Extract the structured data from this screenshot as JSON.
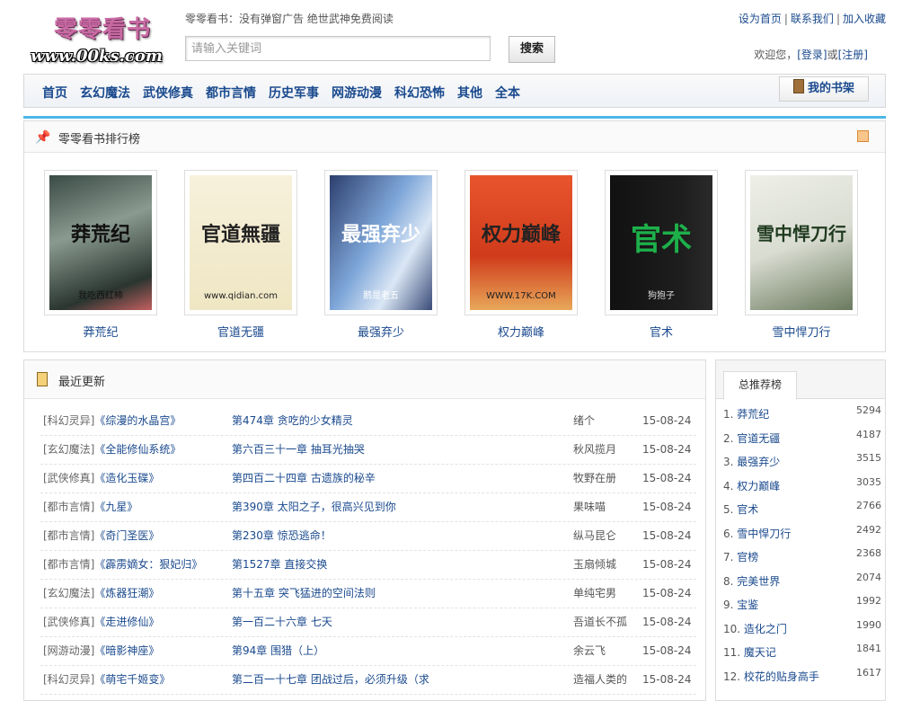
{
  "header": {
    "logo_cn": "零零看书",
    "logo_en": "www.00ks.com",
    "slogan": "零零看书：没有弹窗广告 绝世武神免费阅读",
    "top_links": [
      "设为首页",
      "联系我们",
      "加入收藏"
    ],
    "search_placeholder": "请输入关键词",
    "search_button": "搜索",
    "welcome_text": "欢迎您，",
    "login": "[登录]",
    "or": "或",
    "register": "[注册]"
  },
  "nav": {
    "items": [
      "首页",
      "玄幻魔法",
      "武侠修真",
      "都市言情",
      "历史军事",
      "网游动漫",
      "科幻恐怖",
      "其他",
      "全本"
    ],
    "shelf": "我的书架"
  },
  "ranking": {
    "title": "零零看书排行榜",
    "books": [
      {
        "name": "莽荒纪",
        "cover_title": "莽荒纪",
        "cover_author": "我吃西红柿"
      },
      {
        "name": "官道无疆",
        "cover_title": "官道無疆",
        "cover_author": "www.qidian.com"
      },
      {
        "name": "最强弃少",
        "cover_title": "最强弃少",
        "cover_author": "鹅是老五"
      },
      {
        "name": "权力巅峰",
        "cover_title": "权力巅峰",
        "cover_author": "WWW.17K.COM"
      },
      {
        "name": "官术",
        "cover_title": "官术",
        "cover_author": "狗狍子"
      },
      {
        "name": "雪中悍刀行",
        "cover_title": "雪中悍刀行",
        "cover_author": ""
      }
    ]
  },
  "recent": {
    "title": "最近更新",
    "rows": [
      {
        "cat": "[科幻灵异]",
        "book": "《综漫的水晶宫》",
        "chapter": "第474章 贪吃的少女精灵",
        "author": "绪个",
        "date": "15-08-24"
      },
      {
        "cat": "[玄幻魔法]",
        "book": "《全能修仙系统》",
        "chapter": "第六百三十一章 抽耳光抽哭",
        "author": "秋风揽月",
        "date": "15-08-24"
      },
      {
        "cat": "[武侠修真]",
        "book": "《造化玉碟》",
        "chapter": "第四百二十四章 古遗族的秘辛",
        "author": "牧野在册",
        "date": "15-08-24"
      },
      {
        "cat": "[都市言情]",
        "book": "《九星》",
        "chapter": "第390章 太阳之子，很高兴见到你",
        "author": "果味喵",
        "date": "15-08-24"
      },
      {
        "cat": "[都市言情]",
        "book": "《奇门圣医》",
        "chapter": "第230章 惊恐逃命！",
        "author": "纵马昆仑",
        "date": "15-08-24"
      },
      {
        "cat": "[都市言情]",
        "book": "《霹雳嫡女：狠妃归》",
        "chapter": "第1527章 直接交换",
        "author": "玉扇倾城",
        "date": "15-08-24"
      },
      {
        "cat": "[玄幻魔法]",
        "book": "《炼器狂潮》",
        "chapter": "第十五章 突飞猛进的空间法则",
        "author": "单纯宅男",
        "date": "15-08-24"
      },
      {
        "cat": "[武侠修真]",
        "book": "《走进修仙》",
        "chapter": "第一百二十六章 七天",
        "author": "吾道长不孤",
        "date": "15-08-24"
      },
      {
        "cat": "[网游动漫]",
        "book": "《暗影神座》",
        "chapter": "第94章 围猎（上）",
        "author": "余云飞",
        "date": "15-08-24"
      },
      {
        "cat": "[科幻灵异]",
        "book": "《萌宅千姬变》",
        "chapter": "第二百一十七章 团战过后，必须升级（求",
        "author": "造福人类的",
        "date": "15-08-24"
      }
    ]
  },
  "sidebar": {
    "tab": "总推荐榜",
    "items": [
      {
        "no": "1.",
        "name": "莽荒纪",
        "count": "5294"
      },
      {
        "no": "2.",
        "name": "官道无疆",
        "count": "4187"
      },
      {
        "no": "3.",
        "name": "最强弃少",
        "count": "3515"
      },
      {
        "no": "4.",
        "name": "权力巅峰",
        "count": "3035"
      },
      {
        "no": "5.",
        "name": "官术",
        "count": "2766"
      },
      {
        "no": "6.",
        "name": "雪中悍刀行",
        "count": "2492"
      },
      {
        "no": "7.",
        "name": "官榜",
        "count": "2368"
      },
      {
        "no": "8.",
        "name": "完美世界",
        "count": "2074"
      },
      {
        "no": "9.",
        "name": "宝鉴",
        "count": "1992"
      },
      {
        "no": "10.",
        "name": "造化之门",
        "count": "1990"
      },
      {
        "no": "11.",
        "name": "魔天记",
        "count": "1841"
      },
      {
        "no": "12.",
        "name": "校花的贴身高手",
        "count": "1617"
      }
    ]
  },
  "colors": {
    "link": "#1a4a8e",
    "accent_line": "#4db7e8"
  }
}
